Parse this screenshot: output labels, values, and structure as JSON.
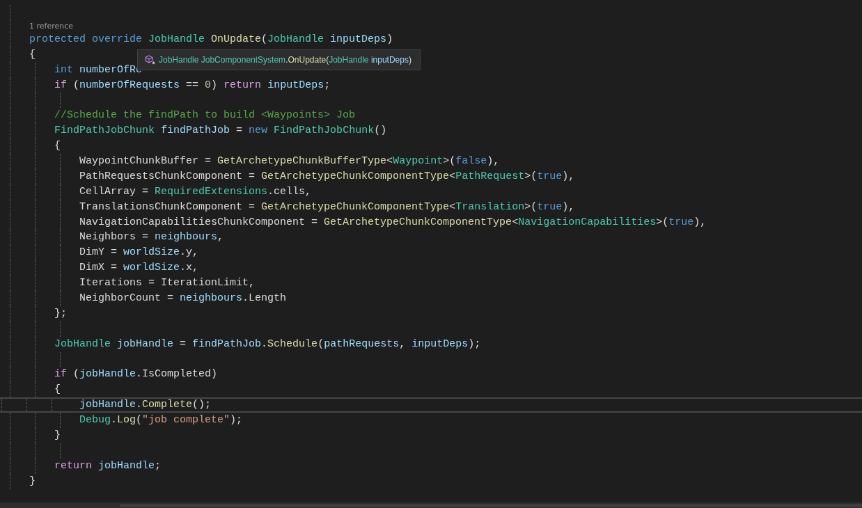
{
  "lines": [
    {
      "kind": "code",
      "current": false
    },
    {
      "kind": "codelens",
      "text": "1 reference"
    },
    {
      "kind": "code",
      "current": false,
      "tokens": [
        {
          "text": "    protected ",
          "kind": "keyword"
        },
        {
          "text": "override ",
          "kind": "keyword"
        },
        {
          "text": "JobHandle ",
          "kind": "type"
        },
        {
          "text": "OnUpdate",
          "kind": "method"
        },
        {
          "text": "(",
          "kind": "plain"
        },
        {
          "text": "JobHandle ",
          "kind": "type"
        },
        {
          "text": "inputDeps",
          "kind": "variable"
        },
        {
          "text": ")",
          "kind": "plain"
        }
      ]
    },
    {
      "kind": "code",
      "current": false,
      "tokens": [
        {
          "text": "    {",
          "kind": "plain"
        }
      ]
    },
    {
      "kind": "code",
      "current": false,
      "tokens": [
        {
          "text": "        int ",
          "kind": "keyword"
        },
        {
          "text": "numberOfRe",
          "kind": "variable"
        }
      ]
    },
    {
      "kind": "code",
      "current": false,
      "tokens": [
        {
          "text": "        if",
          "kind": "control"
        },
        {
          "text": " (",
          "kind": "plain"
        },
        {
          "text": "numberOfRequests",
          "kind": "variable"
        },
        {
          "text": " == ",
          "kind": "plain"
        },
        {
          "text": "0",
          "kind": "number"
        },
        {
          "text": ") ",
          "kind": "plain"
        },
        {
          "text": "return ",
          "kind": "control"
        },
        {
          "text": "inputDeps",
          "kind": "variable"
        },
        {
          "text": ";",
          "kind": "plain"
        }
      ]
    },
    {
      "kind": "code",
      "current": false
    },
    {
      "kind": "code",
      "current": false,
      "tokens": [
        {
          "text": "        //Schedule the findPath to build <Waypoints> Job",
          "kind": "comment"
        }
      ]
    },
    {
      "kind": "code",
      "current": false,
      "tokens": [
        {
          "text": "        FindPathJobChunk ",
          "kind": "type"
        },
        {
          "text": "findPathJob",
          "kind": "variable"
        },
        {
          "text": " = ",
          "kind": "plain"
        },
        {
          "text": "new ",
          "kind": "keyword"
        },
        {
          "text": "FindPathJobChunk",
          "kind": "type"
        },
        {
          "text": "()",
          "kind": "plain"
        }
      ]
    },
    {
      "kind": "code",
      "current": false,
      "tokens": [
        {
          "text": "        {",
          "kind": "plain"
        }
      ]
    },
    {
      "kind": "code",
      "current": false,
      "tokens": [
        {
          "text": "            WaypointChunkBuffer = ",
          "kind": "plain"
        },
        {
          "text": "GetArchetypeChunkBufferType",
          "kind": "method"
        },
        {
          "text": "<",
          "kind": "plain"
        },
        {
          "text": "Waypoint",
          "kind": "type"
        },
        {
          "text": ">(",
          "kind": "plain"
        },
        {
          "text": "false",
          "kind": "keyword"
        },
        {
          "text": "),",
          "kind": "plain"
        }
      ]
    },
    {
      "kind": "code",
      "current": false,
      "tokens": [
        {
          "text": "            PathRequestsChunkComponent = ",
          "kind": "plain"
        },
        {
          "text": "GetArchetypeChunkComponentType",
          "kind": "method"
        },
        {
          "text": "<",
          "kind": "plain"
        },
        {
          "text": "PathRequest",
          "kind": "type"
        },
        {
          "text": ">(",
          "kind": "plain"
        },
        {
          "text": "true",
          "kind": "keyword"
        },
        {
          "text": "),",
          "kind": "plain"
        }
      ]
    },
    {
      "kind": "code",
      "current": false,
      "tokens": [
        {
          "text": "            CellArray = ",
          "kind": "plain"
        },
        {
          "text": "RequiredExtensions",
          "kind": "type"
        },
        {
          "text": ".cells,",
          "kind": "plain"
        }
      ]
    },
    {
      "kind": "code",
      "current": false,
      "tokens": [
        {
          "text": "            TranslationsChunkComponent = ",
          "kind": "plain"
        },
        {
          "text": "GetArchetypeChunkComponentType",
          "kind": "method"
        },
        {
          "text": "<",
          "kind": "plain"
        },
        {
          "text": "Translation",
          "kind": "type"
        },
        {
          "text": ">(",
          "kind": "plain"
        },
        {
          "text": "true",
          "kind": "keyword"
        },
        {
          "text": "),",
          "kind": "plain"
        }
      ]
    },
    {
      "kind": "code",
      "current": false,
      "tokens": [
        {
          "text": "            NavigationCapabilitiesChunkComponent = ",
          "kind": "plain"
        },
        {
          "text": "GetArchetypeChunkComponentType",
          "kind": "method"
        },
        {
          "text": "<",
          "kind": "plain"
        },
        {
          "text": "NavigationCapabilities",
          "kind": "type"
        },
        {
          "text": ">(",
          "kind": "plain"
        },
        {
          "text": "true",
          "kind": "keyword"
        },
        {
          "text": "),",
          "kind": "plain"
        }
      ]
    },
    {
      "kind": "code",
      "current": false,
      "tokens": [
        {
          "text": "            Neighbors = ",
          "kind": "plain"
        },
        {
          "text": "neighbours",
          "kind": "variable"
        },
        {
          "text": ",",
          "kind": "plain"
        }
      ]
    },
    {
      "kind": "code",
      "current": false,
      "tokens": [
        {
          "text": "            DimY = ",
          "kind": "plain"
        },
        {
          "text": "worldSize",
          "kind": "variable"
        },
        {
          "text": ".y,",
          "kind": "plain"
        }
      ]
    },
    {
      "kind": "code",
      "current": false,
      "tokens": [
        {
          "text": "            DimX = ",
          "kind": "plain"
        },
        {
          "text": "worldSize",
          "kind": "variable"
        },
        {
          "text": ".x,",
          "kind": "plain"
        }
      ]
    },
    {
      "kind": "code",
      "current": false,
      "tokens": [
        {
          "text": "            Iterations = IterationLimit,",
          "kind": "plain"
        }
      ]
    },
    {
      "kind": "code",
      "current": false,
      "tokens": [
        {
          "text": "            NeighborCount = ",
          "kind": "plain"
        },
        {
          "text": "neighbours",
          "kind": "variable"
        },
        {
          "text": ".Length",
          "kind": "plain"
        }
      ]
    },
    {
      "kind": "code",
      "current": false,
      "tokens": [
        {
          "text": "        };",
          "kind": "plain"
        }
      ]
    },
    {
      "kind": "code",
      "current": false
    },
    {
      "kind": "code",
      "current": false,
      "tokens": [
        {
          "text": "        JobHandle ",
          "kind": "type"
        },
        {
          "text": "jobHandle",
          "kind": "variable"
        },
        {
          "text": " = ",
          "kind": "plain"
        },
        {
          "text": "findPathJob",
          "kind": "variable"
        },
        {
          "text": ".",
          "kind": "plain"
        },
        {
          "text": "Schedule",
          "kind": "method"
        },
        {
          "text": "(",
          "kind": "plain"
        },
        {
          "text": "pathRequests",
          "kind": "variable"
        },
        {
          "text": ", ",
          "kind": "plain"
        },
        {
          "text": "inputDeps",
          "kind": "variable"
        },
        {
          "text": ");",
          "kind": "plain"
        }
      ]
    },
    {
      "kind": "code",
      "current": false
    },
    {
      "kind": "code",
      "current": false,
      "tokens": [
        {
          "text": "        if",
          "kind": "control"
        },
        {
          "text": " (",
          "kind": "plain"
        },
        {
          "text": "jobHandle",
          "kind": "variable"
        },
        {
          "text": ".IsCompleted)",
          "kind": "plain"
        }
      ]
    },
    {
      "kind": "code",
      "current": false,
      "tokens": [
        {
          "text": "        {",
          "kind": "plain"
        }
      ]
    },
    {
      "kind": "code",
      "current": true,
      "tokens": [
        {
          "text": "            jobHandle",
          "kind": "variable"
        },
        {
          "text": ".",
          "kind": "plain"
        },
        {
          "text": "Complete",
          "kind": "method"
        },
        {
          "text": "();",
          "kind": "plain"
        }
      ]
    },
    {
      "kind": "code",
      "current": false,
      "tokens": [
        {
          "text": "            Debug",
          "kind": "type"
        },
        {
          "text": ".",
          "kind": "plain"
        },
        {
          "text": "Log",
          "kind": "method"
        },
        {
          "text": "(",
          "kind": "plain"
        },
        {
          "text": "\"job complete\"",
          "kind": "string"
        },
        {
          "text": ");",
          "kind": "plain"
        }
      ]
    },
    {
      "kind": "code",
      "current": false,
      "tokens": [
        {
          "text": "        }",
          "kind": "plain"
        }
      ]
    },
    {
      "kind": "code",
      "current": false
    },
    {
      "kind": "code",
      "current": false,
      "tokens": [
        {
          "text": "        return ",
          "kind": "control"
        },
        {
          "text": "jobHandle",
          "kind": "variable"
        },
        {
          "text": ";",
          "kind": "plain"
        }
      ]
    },
    {
      "kind": "code",
      "current": false,
      "tokens": [
        {
          "text": "    }",
          "kind": "plain"
        }
      ]
    }
  ],
  "tooltip": {
    "tokens": [
      {
        "text": "JobHandle ",
        "kind": "type"
      },
      {
        "text": "JobComponentSystem",
        "kind": "type"
      },
      {
        "text": ".",
        "kind": "plain"
      },
      {
        "text": "OnUpdate",
        "kind": "method"
      },
      {
        "text": "(",
        "kind": "plain"
      },
      {
        "text": "JobHandle ",
        "kind": "type"
      },
      {
        "text": "inputDeps",
        "kind": "variable"
      },
      {
        "text": ")",
        "kind": "plain"
      }
    ]
  }
}
